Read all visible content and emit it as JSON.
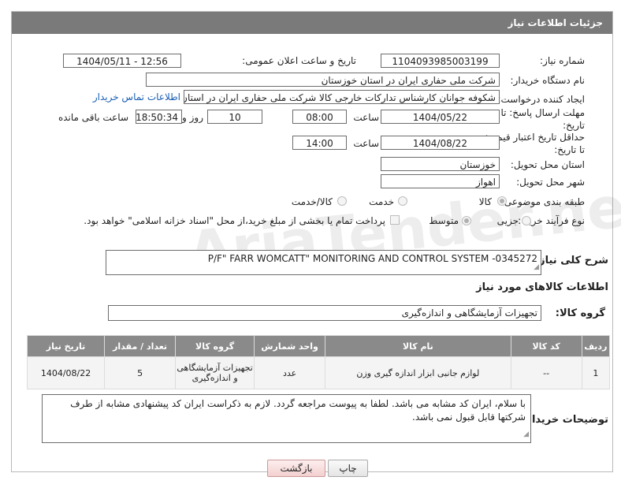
{
  "header": {
    "title": "جزئیات اطلاعات نیاز"
  },
  "fields": {
    "need_number_label": "شماره نیاز:",
    "need_number": "1104093985003199",
    "announce_label": "تاریخ و ساعت اعلان عمومی:",
    "announce_value": "1404/05/11 - 12:56",
    "buyer_org_label": "نام دستگاه خریدار:",
    "buyer_org": "شرکت ملی حفاری ایران در استان خوزستان",
    "creator_label": "ایجاد کننده درخواست:",
    "creator": "شکوفه جوانان کارشناس تدارکات خارجی کالا شرکت ملی حفاری ایران در استان",
    "contact_link": "اطلاعات تماس خریدار",
    "deadline_label_1": "مهلت ارسال پاسخ: تا",
    "deadline_label_2": "تاریخ:",
    "deadline_date": "1404/05/22",
    "time_label": "ساعت",
    "deadline_time": "08:00",
    "days_value": "10",
    "days_label": "روز و",
    "remaining_time": "18:50:34",
    "remaining_label": "ساعت باقی مانده",
    "price_validity_label_1": "حداقل تاریخ اعتبار قیمت:",
    "price_validity_label_2": "تا تاریخ:",
    "price_validity_date": "1404/08/22",
    "price_validity_time": "14:00",
    "province_label": "استان محل تحویل:",
    "province": "خوزستان",
    "city_label": "شهر محل تحویل:",
    "city": "اهواز",
    "category_label": "طبقه بندی موضوعی:",
    "category_options": [
      "کالا",
      "خدمت",
      "کالا/خدمت"
    ],
    "process_label": "نوع فرآیند خرید :",
    "process_options": [
      "جزیی",
      "متوسط"
    ],
    "payment_note": "پرداخت تمام یا بخشی از مبلغ خرید،از محل \"اسناد خزانه اسلامی\" خواهد بود."
  },
  "summary": {
    "label": "شرح کلی نیاز:",
    "value": "P/F\" FARR WOMCATT\" MONITORING AND CONTROL SYSTEM -0345272"
  },
  "items_section": {
    "title": "اطلاعات کالاهای مورد نیاز",
    "group_label": "گروه کالا:",
    "group_value": "تجهیزات آزمایشگاهی و اندازه‌گیری",
    "columns": [
      "ردیف",
      "کد کالا",
      "نام کالا",
      "واحد شمارش",
      "گروه کالا",
      "تعداد / مقدار",
      "تاریخ نیاز"
    ],
    "rows": [
      {
        "row": "1",
        "code": "--",
        "name": "لوازم جانبی ابزار اندازه گیری وزن",
        "unit": "عدد",
        "group": "تجهیزات آزمایشگاهی و اندازه‌گیری",
        "qty": "5",
        "date": "1404/08/22"
      }
    ]
  },
  "buyer_notes": {
    "label": "توضیحات خریدار:",
    "text": "با سلام، ایران کد مشابه می باشد. لطفا به پیوست مراجعه گردد. لازم به ذکراست ایران کد پیشنهادی مشابه از طرف شرکتها قابل قبول نمی باشد."
  },
  "buttons": {
    "print": "چاپ",
    "back": "بازگشت"
  },
  "watermark": "AriaTender.neT"
}
